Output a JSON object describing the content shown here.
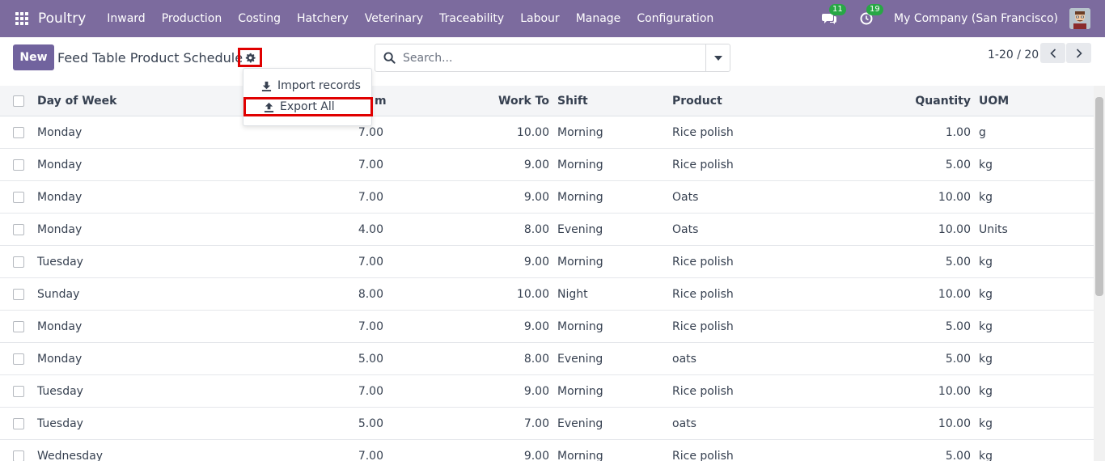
{
  "navbar": {
    "brand": "Poultry",
    "menu": [
      "Inward",
      "Production",
      "Costing",
      "Hatchery",
      "Veterinary",
      "Traceability",
      "Labour",
      "Manage",
      "Configuration"
    ],
    "messages_count": "11",
    "activities_count": "19",
    "company": "My Company (San Francisco)"
  },
  "control_panel": {
    "new_label": "New",
    "title": "Feed Table Product Schedule",
    "search_placeholder": "Search...",
    "pager": "1-20 / 20"
  },
  "dropdown": {
    "import_label": "Import records",
    "export_label": "Export All"
  },
  "table": {
    "headers": {
      "day": "Day of Week",
      "work_from": "m",
      "work_to": "Work To",
      "shift": "Shift",
      "product": "Product",
      "quantity": "Quantity",
      "uom": "UOM"
    },
    "rows": [
      {
        "day": "Monday",
        "from": "7.00",
        "to": "10.00",
        "shift": "Morning",
        "product": "Rice polish",
        "qty": "1.00",
        "uom": "g"
      },
      {
        "day": "Monday",
        "from": "7.00",
        "to": "9.00",
        "shift": "Morning",
        "product": "Rice polish",
        "qty": "5.00",
        "uom": "kg"
      },
      {
        "day": "Monday",
        "from": "7.00",
        "to": "9.00",
        "shift": "Morning",
        "product": "Oats",
        "qty": "10.00",
        "uom": "kg"
      },
      {
        "day": "Monday",
        "from": "4.00",
        "to": "8.00",
        "shift": "Evening",
        "product": "Oats",
        "qty": "10.00",
        "uom": "Units"
      },
      {
        "day": "Tuesday",
        "from": "7.00",
        "to": "9.00",
        "shift": "Morning",
        "product": "Rice polish",
        "qty": "5.00",
        "uom": "kg"
      },
      {
        "day": "Sunday",
        "from": "8.00",
        "to": "10.00",
        "shift": "Night",
        "product": "Rice polish",
        "qty": "10.00",
        "uom": "kg"
      },
      {
        "day": "Monday",
        "from": "7.00",
        "to": "9.00",
        "shift": "Morning",
        "product": "Rice polish",
        "qty": "5.00",
        "uom": "kg"
      },
      {
        "day": "Monday",
        "from": "5.00",
        "to": "8.00",
        "shift": "Evening",
        "product": "oats",
        "qty": "5.00",
        "uom": "kg"
      },
      {
        "day": "Tuesday",
        "from": "7.00",
        "to": "9.00",
        "shift": "Morning",
        "product": "Rice polish",
        "qty": "10.00",
        "uom": "kg"
      },
      {
        "day": "Tuesday",
        "from": "5.00",
        "to": "7.00",
        "shift": "Evening",
        "product": "oats",
        "qty": "10.00",
        "uom": "kg"
      },
      {
        "day": "Wednesday",
        "from": "7.00",
        "to": "9.00",
        "shift": "Morning",
        "product": "Rice polish",
        "qty": "5.00",
        "uom": "kg"
      }
    ]
  },
  "colors": {
    "navbar": "#7c6b9e",
    "primary_button": "#71639e",
    "highlight": "#e00000",
    "badge": "#28a745"
  }
}
